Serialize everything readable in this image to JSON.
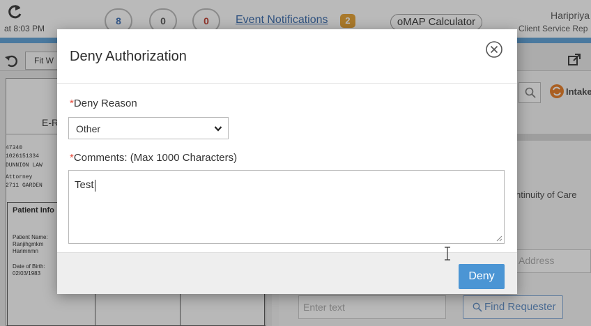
{
  "header": {
    "refresh_time": "at 8:03 PM",
    "counters": [
      "8",
      "0",
      "0"
    ],
    "event_notifications_label": "Event Notifications",
    "event_notifications_count": "2",
    "omap_label": "oMAP Calculator",
    "user_name": "Haripriya",
    "user_role": "Client Service Rep"
  },
  "toolbar": {
    "fit_label": "Fit W"
  },
  "document": {
    "title": "E-R",
    "lines": [
      "47340",
      "1026151334",
      "DUNNION LAW",
      "Attorney",
      "2711 GARDEN"
    ],
    "patient_header": "Patient Info",
    "patient_name_label": "Patient Name:",
    "patient_name_1": "Ranjihgmkm",
    "patient_name_2": "Harimnmn",
    "dob_label": "Date of Birth:",
    "dob_value": "02/03/1983"
  },
  "right_panel": {
    "intake_label": "Intake",
    "continuity_text": "ntinuity of Care",
    "address_placeholder": "Address",
    "enter_text_placeholder": "Enter text",
    "find_requester_label": "Find Requester"
  },
  "modal": {
    "title": "Deny Authorization",
    "deny_reason_label": "Deny Reason",
    "deny_reason_value": "Other",
    "comments_label": "Comments: (Max 1000 Characters)",
    "comments_value": "Test",
    "required_marker": "*",
    "deny_button_label": "Deny"
  },
  "colors": {
    "primary_button": "#4b95d4",
    "required": "#e74c3c",
    "event_badge": "#e6a02d",
    "accent_bar": "#5aa0d8"
  },
  "icons": [
    "refresh-icon",
    "undo-icon",
    "external-link-icon",
    "search-icon",
    "intake-icon",
    "close-icon",
    "chevron-down-icon",
    "resize-grip-icon",
    "text-cursor-icon"
  ]
}
